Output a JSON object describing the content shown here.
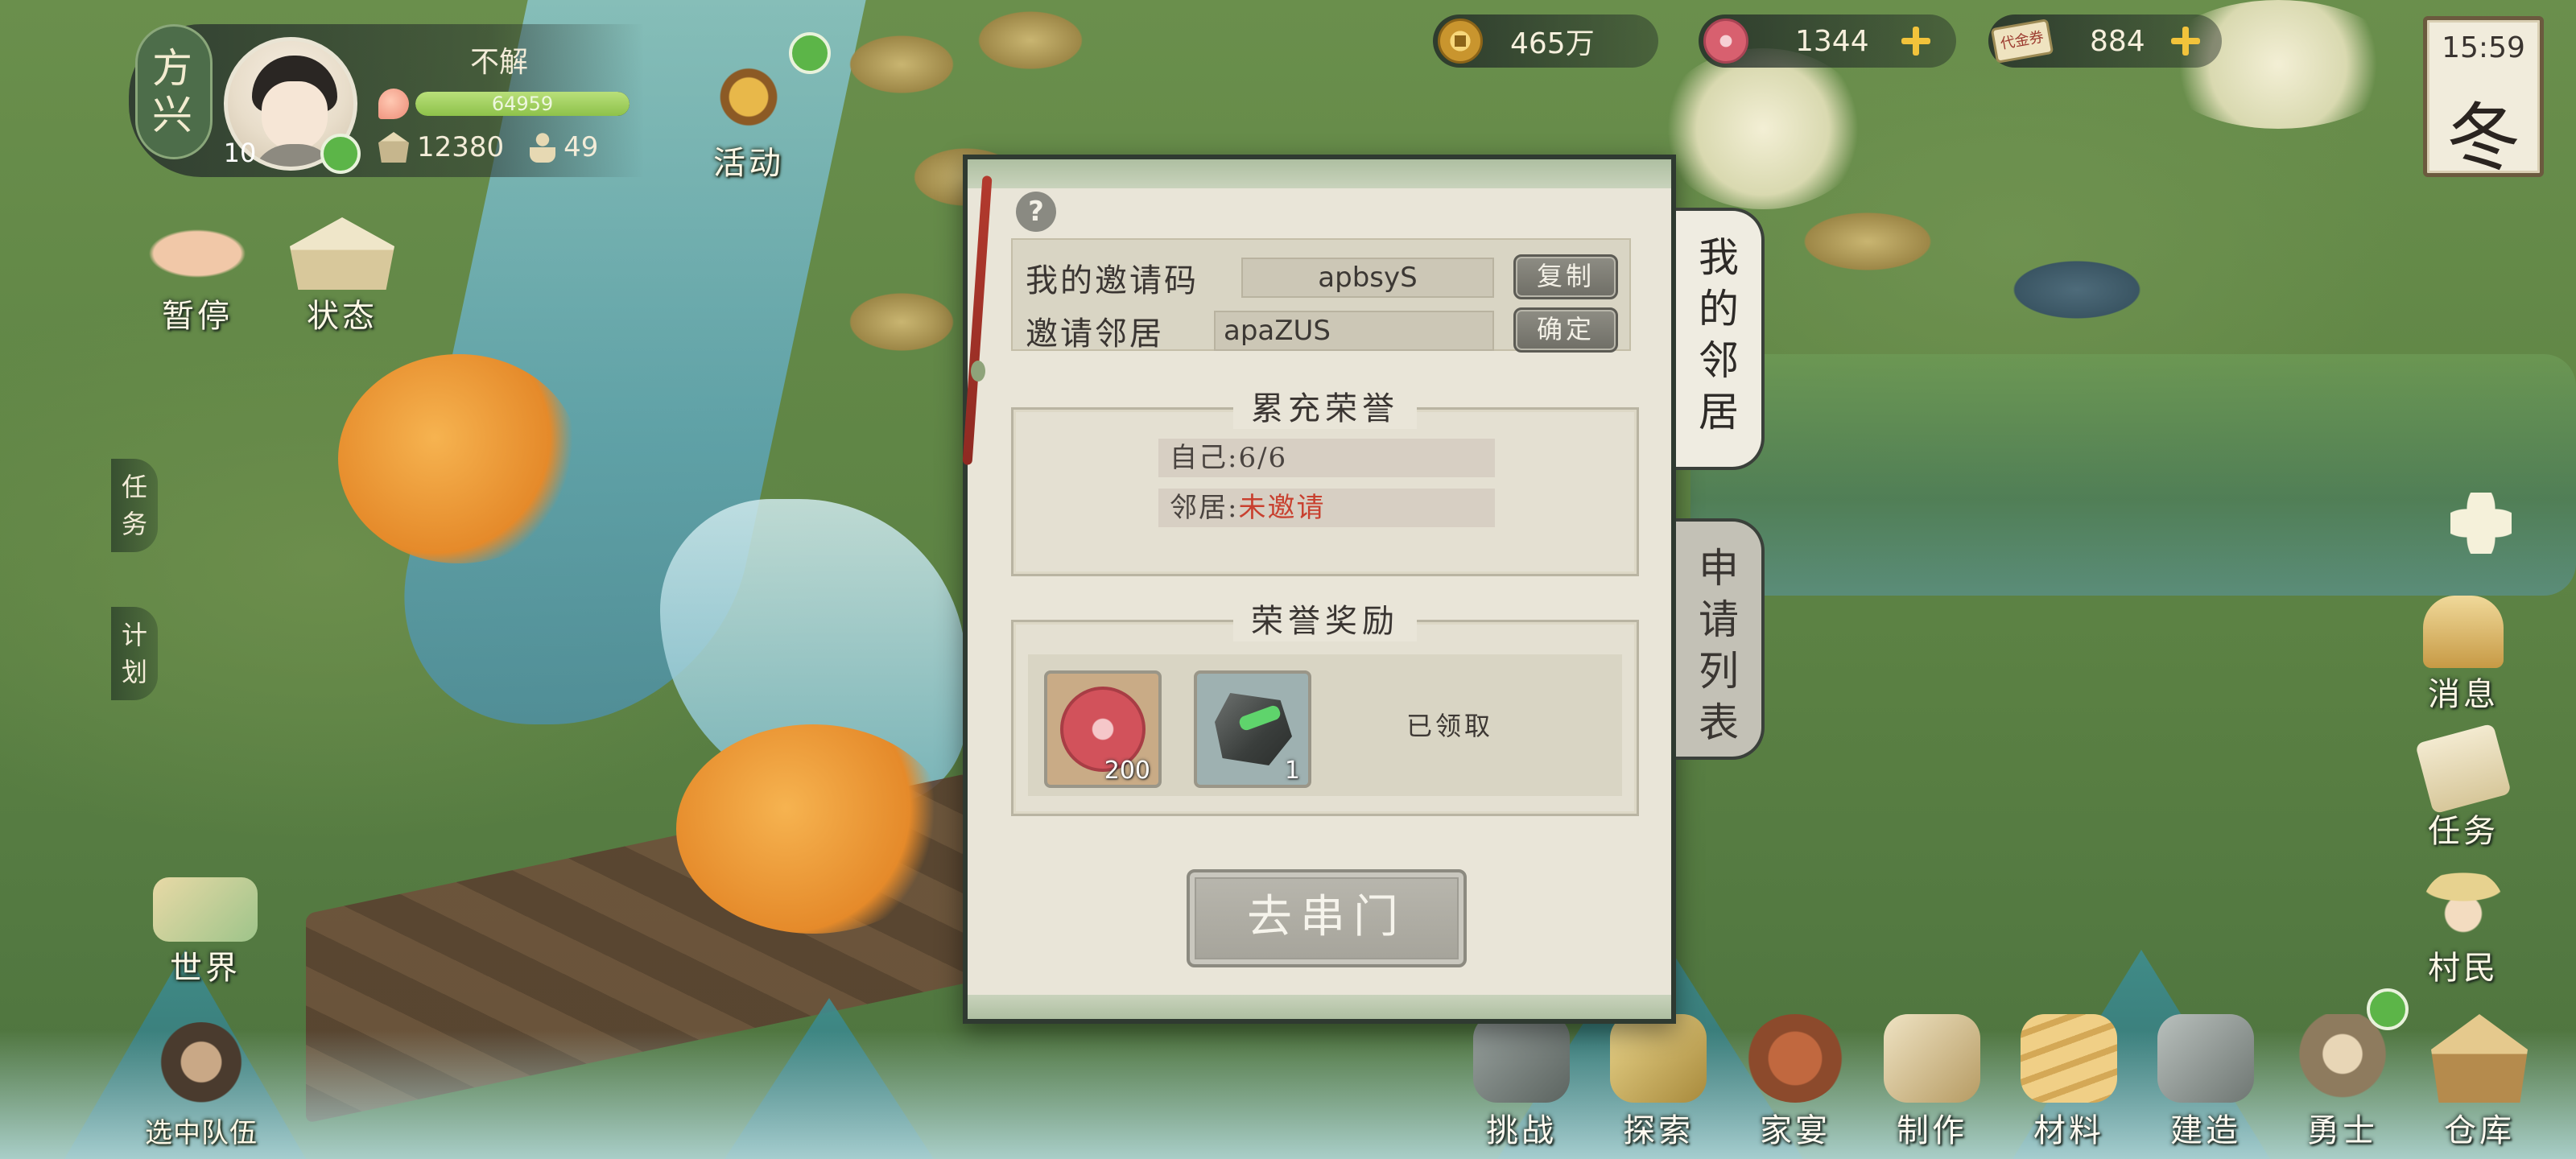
{
  "player": {
    "clan_char_1": "方",
    "clan_char_2": "兴",
    "name": "不解",
    "level": "10",
    "exp": "64959",
    "exp_fill": 1.0,
    "food": "12380",
    "population": "49"
  },
  "left_menu": {
    "activity": "活动",
    "pause": "暂停",
    "status": "状态",
    "task_tab_1": "任",
    "task_tab_2": "务",
    "plan_tab_1": "计",
    "plan_tab_2": "划",
    "world": "世界",
    "team": "选中队伍"
  },
  "resources": {
    "coins": "465万",
    "flowers": "1344",
    "ticket_label": "代金券",
    "tickets": "884"
  },
  "season": {
    "time": "15:59",
    "name": "冬"
  },
  "right_menu": {
    "messages": "消息",
    "tasks": "任务",
    "villagers": "村民"
  },
  "toolbar": {
    "items": [
      "挑战",
      "探索",
      "家宴",
      "制作",
      "材料",
      "建造",
      "勇士",
      "仓库"
    ]
  },
  "modal": {
    "my_code_label": "我的邀请码",
    "my_code": "apbsyS",
    "copy_button": "复制",
    "invite_label": "邀请邻居",
    "invite_value": "apaZUS",
    "confirm_button": "确定",
    "honor_title": "累充荣誉",
    "self_label": "自己:",
    "self_value": "6/6",
    "neighbor_label": "邻居:",
    "neighbor_value": "未邀请",
    "reward_title": "荣誉奖励",
    "reward_1_qty": "200",
    "reward_2_qty": "1",
    "claimed_text": "已领取",
    "visit_button": "去串门",
    "tab_neighbors": [
      "我",
      "的",
      "邻",
      "居"
    ],
    "tab_requests": [
      "申",
      "请",
      "列",
      "表"
    ]
  },
  "colors": {
    "accent_red": "#c8402f",
    "panel_bg": "#e9e5d8",
    "online_green": "#5cb548"
  }
}
